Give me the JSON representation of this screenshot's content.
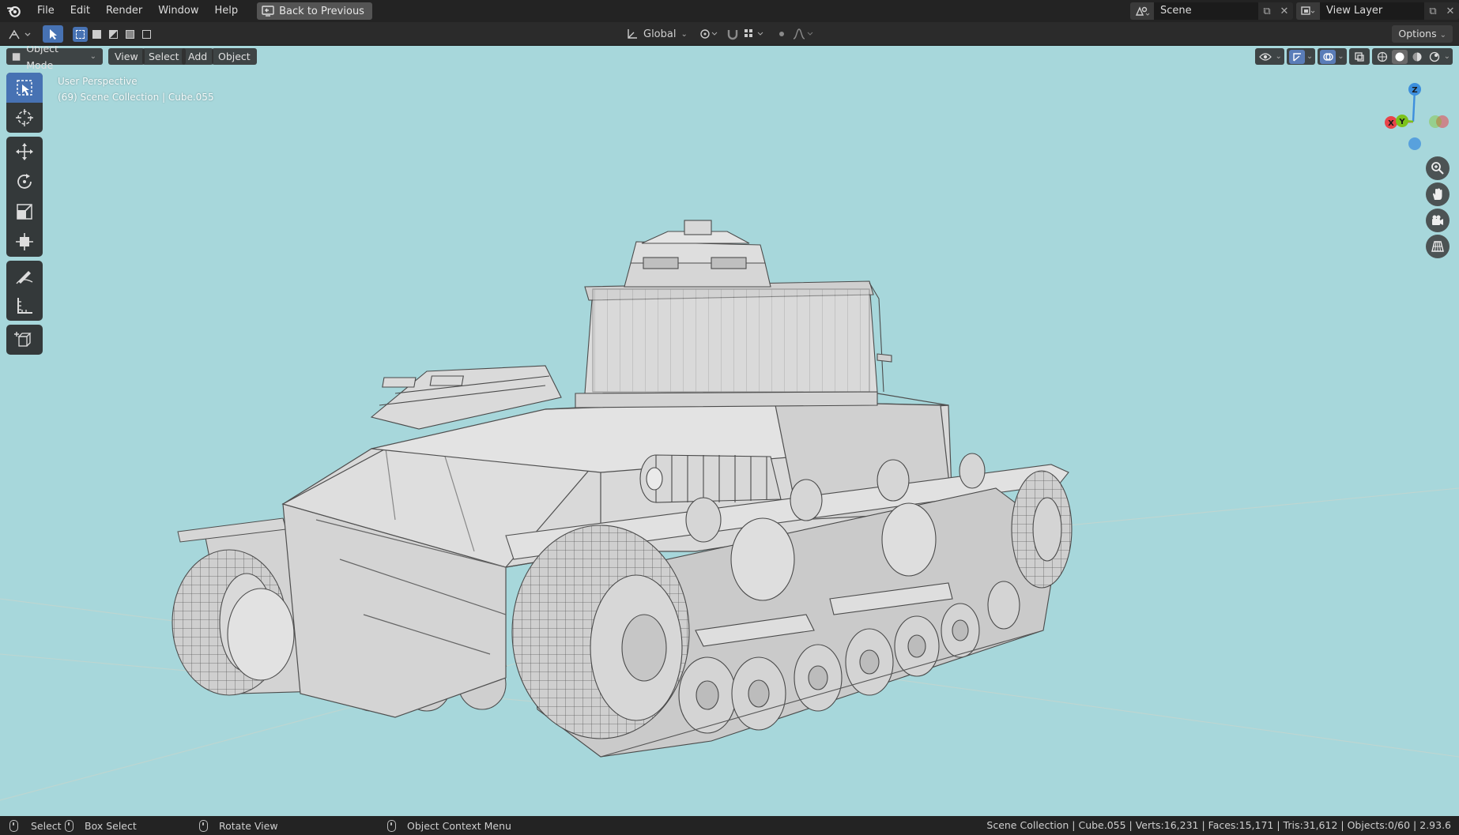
{
  "menu": {
    "items": [
      "File",
      "Edit",
      "Render",
      "Window",
      "Help"
    ],
    "back_button": "Back to Previous"
  },
  "workspace": {
    "scene_name": "Scene",
    "view_layer": "View Layer"
  },
  "tool_header": {
    "transform_orientation": "Global",
    "options_label": "Options"
  },
  "viewport_header": {
    "mode": "Object Mode",
    "menus": [
      "View",
      "Select",
      "Add",
      "Object"
    ]
  },
  "viewport": {
    "perspective_label": "User Perspective",
    "collection_label": "(69) Scene Collection | Cube.055",
    "background_color": "#a7d7db"
  },
  "gizmo": {
    "axis_z": "Z",
    "axis_x": "X",
    "axis_y": "Y",
    "x_color": "#e8444a",
    "y_color": "#7cc21b",
    "z_color": "#3d8fdd"
  },
  "toolbar": {
    "tools": [
      "select-box-icon",
      "cursor-icon",
      "move-icon",
      "rotate-icon",
      "scale-icon",
      "transform-icon",
      "annotate-icon",
      "measure-icon",
      "add-cube-icon"
    ]
  },
  "statusbar": {
    "select": "Select",
    "box_select": "Box Select",
    "rotate_view": "Rotate View",
    "context_menu": "Object Context Menu",
    "stats": "Scene Collection | Cube.055 | Verts:16,231 | Faces:15,171 | Tris:31,612 | Objects:0/60 | 2.93.6"
  },
  "accent_color": "#4772b3"
}
